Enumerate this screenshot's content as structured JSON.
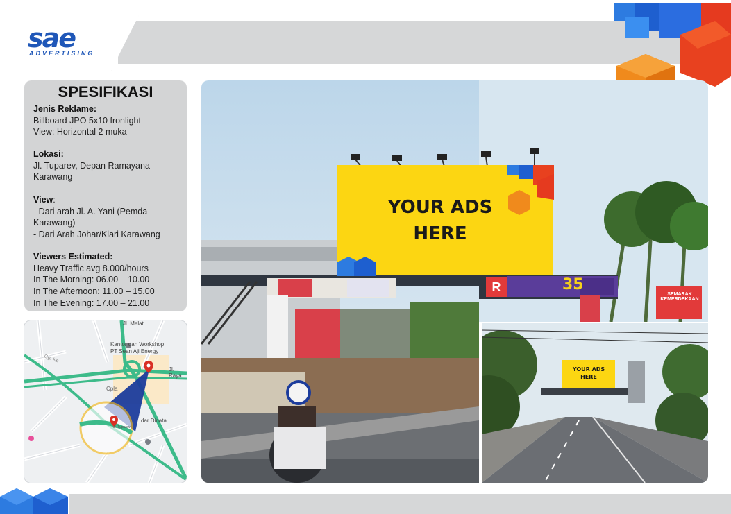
{
  "brand": {
    "logo_text": "sae",
    "logo_sub": "ADVERTISING"
  },
  "spec": {
    "title": "SPESIFIKASI",
    "jenis_label": "Jenis Reklame:",
    "jenis_lines": [
      "Billboard JPO 5x10 fronlight",
      "View: Horizontal 2 muka"
    ],
    "lokasi_label": "Lokasi:",
    "lokasi_lines": [
      "Jl. Tuparev, Depan Ramayana",
      "Karawang"
    ],
    "view_label": "View",
    "view_colon": ":",
    "view_lines": [
      "- Dari arah Jl. A. Yani (Pemda",
      "Karawang)",
      "- Dari Arah Johar/Klari Karawang"
    ],
    "viewers_label": "Viewers Estimated:",
    "viewers_lines": [
      "Heavy Traffic avg 8.000/hours",
      "In The Morning: 06.00 – 10.00",
      "In The Afternoon: 11.00 – 15.00",
      "In The Evening: 17.00 – 21.00"
    ]
  },
  "map": {
    "labels": [
      "Jl. Melati",
      "Kantor dan Workshop",
      "PT Sean Aji Energy",
      "Jl. Raya",
      "Cpla",
      "dar Dinata",
      "Jl. Tuparev",
      "Gg. Ke"
    ],
    "pin_color": "#d93025",
    "cone_color": "#1c3c9c",
    "circle_color": "#f3b81c",
    "road_color": "#3dbb8a"
  },
  "billboard": {
    "line1": "YOUR ADS",
    "line2": "HERE",
    "color": "#fcd612"
  },
  "small_billboard": {
    "line1": "YOUR ADS",
    "line2": "HERE"
  },
  "scene": {
    "bridge_sign_number": "35",
    "bridge_sign_r": "R",
    "bridge_banner": "SEMARAK KEMERDEKAAN"
  },
  "colors": {
    "brand_blue": "#1f57b8",
    "brand_orange": "#f08a1c",
    "panel_gray": "#d3d4d5"
  }
}
